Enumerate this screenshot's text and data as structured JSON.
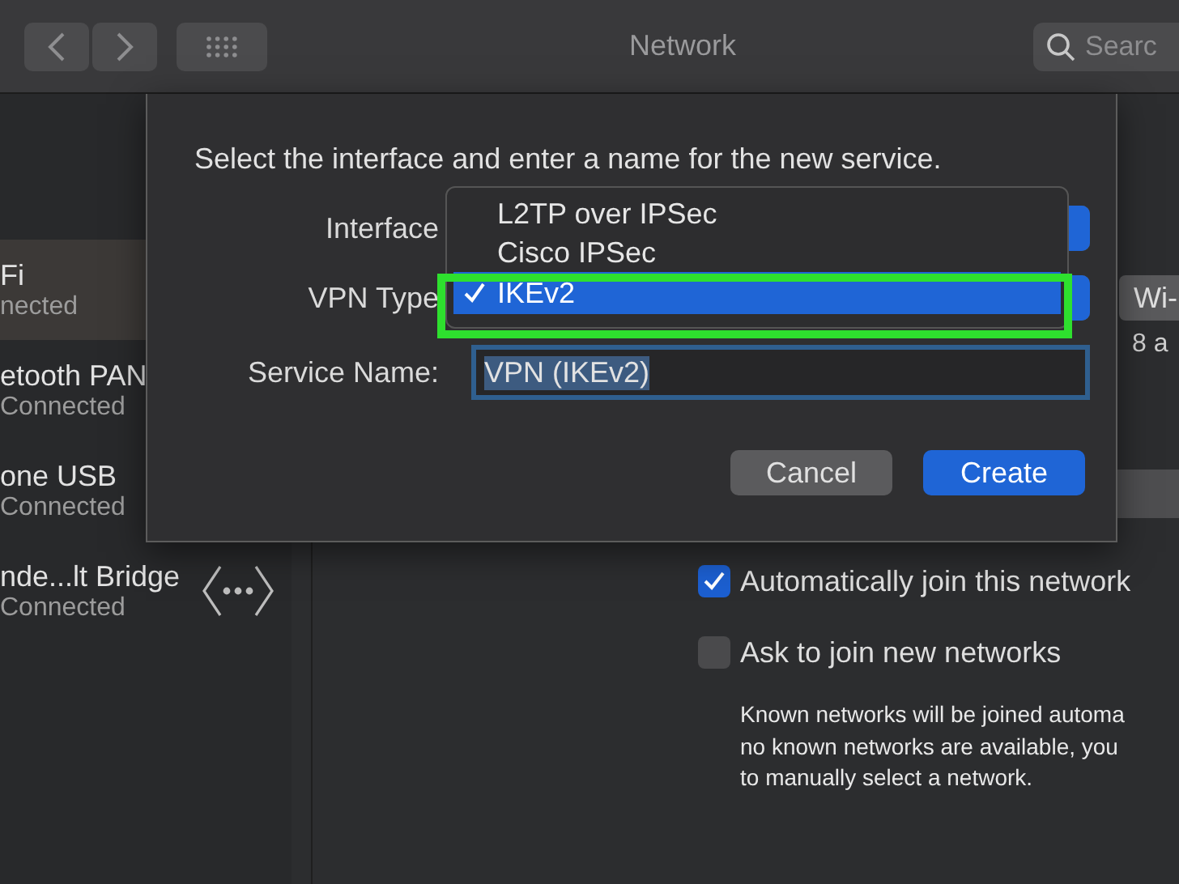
{
  "toolbar": {
    "title": "Network",
    "search": {
      "placeholder": "Searc"
    }
  },
  "sidebar": {
    "items": [
      {
        "name": "Fi",
        "status": "nected",
        "selected": true,
        "kind": "service"
      },
      {
        "name": "etooth PAN",
        "status": "Connected",
        "selected": false,
        "kind": "service"
      },
      {
        "name": "one USB",
        "status": "Connected",
        "selected": false,
        "kind": "service"
      },
      {
        "name": "nde...lt Bridge",
        "status": "Connected",
        "selected": false,
        "kind": "bridge"
      }
    ]
  },
  "main": {
    "popup_value": "Wi-",
    "partial_text": "8 a",
    "options": [
      {
        "label": "Automatically join this network",
        "checked": true
      },
      {
        "label": "Ask to join new networks",
        "checked": false
      }
    ],
    "note": "Known networks will be joined automa\nno known networks are available, you\nto manually select a network."
  },
  "dialog": {
    "instruction": "Select the interface and enter a name for the new service.",
    "fields": [
      {
        "label": "Interface",
        "kind": "popup"
      },
      {
        "label": "VPN Type",
        "kind": "popup"
      },
      {
        "label": "Service Name:",
        "kind": "text",
        "value": "VPN (IKEv2)",
        "value_selected": true
      }
    ],
    "menu": [
      {
        "label": "L2TP over IPSec",
        "selected": false,
        "highlighted": false
      },
      {
        "label": "Cisco IPSec",
        "selected": false,
        "highlighted": false
      },
      {
        "label": "IKEv2",
        "selected": true,
        "highlighted": true
      }
    ],
    "buttons": [
      {
        "label": "Cancel",
        "kind": "default"
      },
      {
        "label": "Create",
        "kind": "primary"
      }
    ]
  }
}
